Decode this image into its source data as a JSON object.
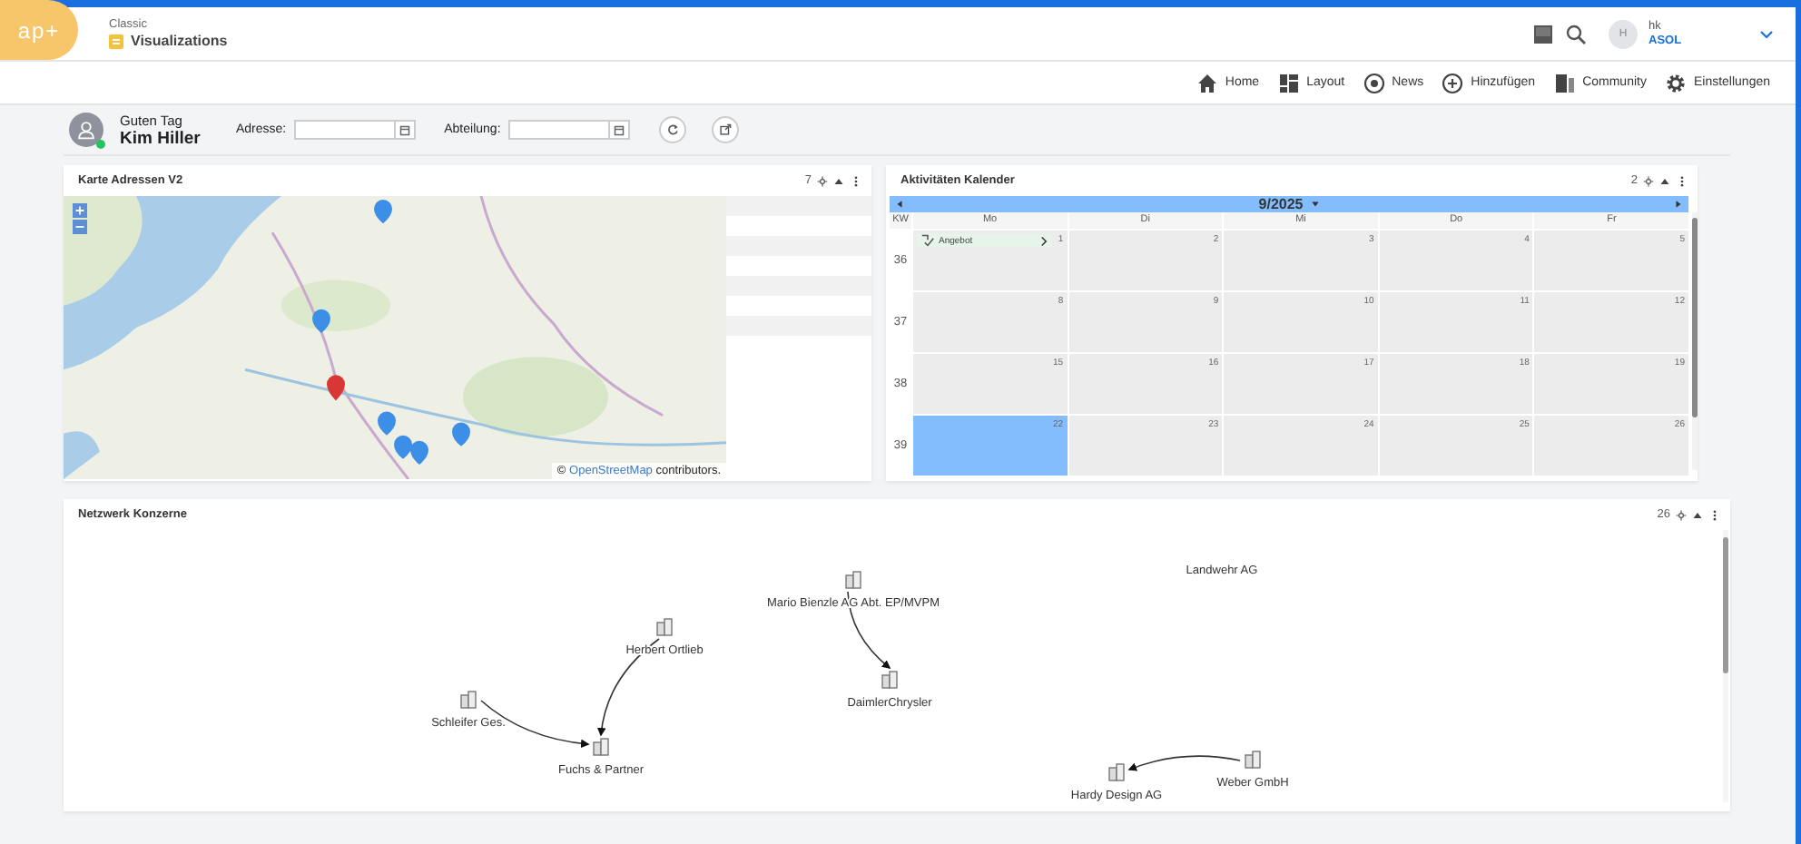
{
  "header": {
    "logo": "ap+",
    "breadcrumb": "Classic",
    "title": "Visualizations",
    "user": {
      "initial": "H",
      "name": "hk",
      "company": "ASOL"
    }
  },
  "nav": [
    {
      "label": "Home"
    },
    {
      "label": "Layout"
    },
    {
      "label": "News"
    },
    {
      "label": "Hinzufügen"
    },
    {
      "label": "Community"
    },
    {
      "label": "Einstellungen"
    }
  ],
  "greeting": {
    "salutation": "Guten Tag",
    "name": "Kim Hiller",
    "online": true
  },
  "filters": [
    {
      "label": "Adresse:"
    },
    {
      "label": "Abteilung:"
    }
  ],
  "map_widget": {
    "title": "Karte Adressen V2",
    "count": "7",
    "attribution": {
      "prefix": "©",
      "link": "OpenStreetMap",
      "suffix": "contributors."
    }
  },
  "calendar_widget": {
    "title": "Aktivitäten Kalender",
    "count": "2",
    "month": "9/2025",
    "week_label": "KW",
    "days": [
      "Mo",
      "Di",
      "Mi",
      "Do",
      "Fr"
    ],
    "weeks": [
      {
        "number": "36",
        "dates": [
          {
            "day": "1",
            "selected": false,
            "events": [
              "Angebot"
            ]
          },
          {
            "day": "2",
            "selected": false
          },
          {
            "day": "3",
            "selected": false
          },
          {
            "day": "4",
            "selected": false
          },
          {
            "day": "5",
            "selected": false
          }
        ]
      },
      {
        "number": "37",
        "dates": [
          {
            "day": "8",
            "selected": false
          },
          {
            "day": "9",
            "selected": false
          },
          {
            "day": "10",
            "selected": false
          },
          {
            "day": "11",
            "selected": false
          },
          {
            "day": "12",
            "selected": false
          }
        ]
      },
      {
        "number": "38",
        "dates": [
          {
            "day": "15",
            "selected": false
          },
          {
            "day": "16",
            "selected": false
          },
          {
            "day": "17",
            "selected": false
          },
          {
            "day": "18",
            "selected": false
          },
          {
            "day": "19",
            "selected": false
          }
        ]
      },
      {
        "number": "39",
        "dates": [
          {
            "day": "22",
            "selected": true
          },
          {
            "day": "23",
            "selected": false
          },
          {
            "day": "24",
            "selected": false
          },
          {
            "day": "25",
            "selected": false
          },
          {
            "day": "26",
            "selected": false
          }
        ]
      }
    ]
  },
  "network_widget": {
    "title": "Netzwerk Konzerne",
    "count": "26",
    "nodes": [
      {
        "label": "Landwehr AG"
      },
      {
        "label": "Mario Bienzle AG Abt. EP/MVPM"
      },
      {
        "label": "Herbert Ortlieb"
      },
      {
        "label": "DaimlerChrysler"
      },
      {
        "label": "Schleifer Ges."
      },
      {
        "label": "Fuchs & Partner"
      },
      {
        "label": "Weber GmbH"
      },
      {
        "label": "Hardy Design AG"
      }
    ]
  }
}
